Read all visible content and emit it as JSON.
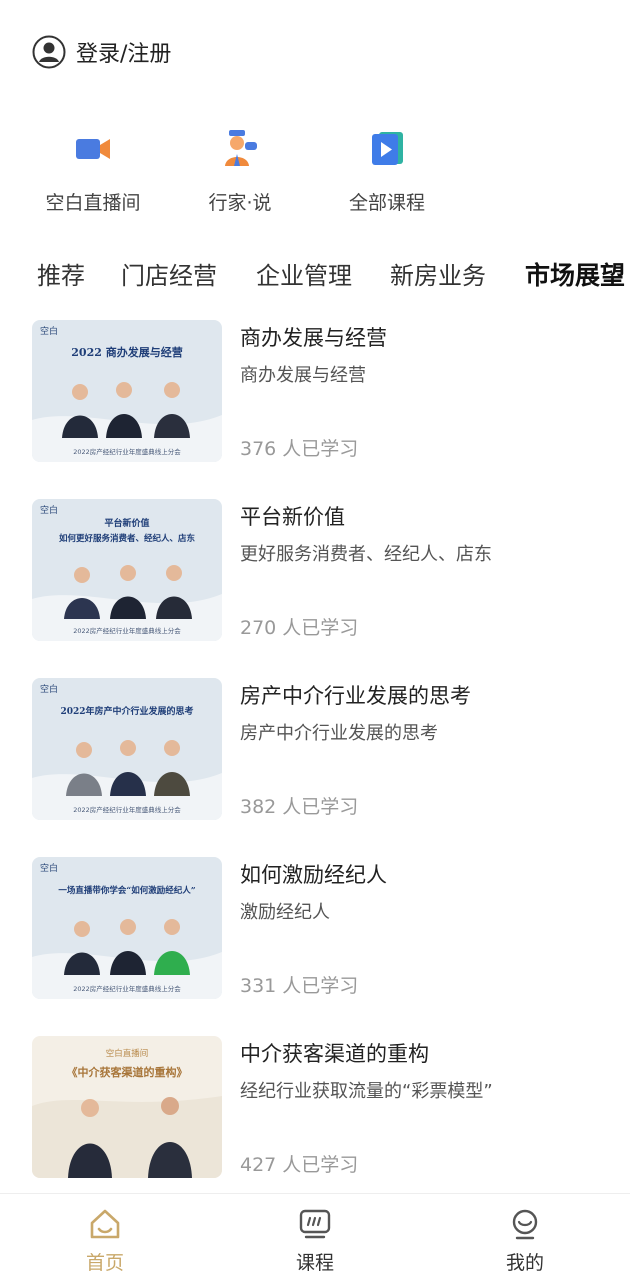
{
  "header": {
    "login_label": "登录/注册",
    "avatar_icon": "user-circle-icon"
  },
  "quick_links": [
    {
      "label": "空白直播间",
      "icon": "video-camera-icon",
      "color": "#4a7be0"
    },
    {
      "label": "行家·说",
      "icon": "speaker-person-icon",
      "color": "#f08a3c"
    },
    {
      "label": "全部课程",
      "icon": "play-book-icon",
      "color": "#3f7ce8"
    }
  ],
  "tabs": [
    {
      "label": "推荐",
      "active": false
    },
    {
      "label": "门店经营",
      "active": false
    },
    {
      "label": "企业管理",
      "active": false
    },
    {
      "label": "新房业务",
      "active": false
    },
    {
      "label": "市场展望",
      "active": true
    }
  ],
  "courses": [
    {
      "title": "商办发展与经营",
      "subtitle": "商办发展与经营",
      "count": "376 人已学习",
      "thumb": {
        "logo": "空白",
        "heading": "2022 商办发展与经营",
        "footer": "2022房产经纪行业年度盛典线上分会"
      }
    },
    {
      "title": "平台新价值",
      "subtitle": "更好服务消费者、经纪人、店东",
      "count": "270 人已学习",
      "thumb": {
        "logo": "空白",
        "heading": "平台新价值",
        "heading2": "如何更好服务消费者、经纪人、店东",
        "footer": "2022房产经纪行业年度盛典线上分会"
      }
    },
    {
      "title": "房产中介行业发展的思考",
      "subtitle": "房产中介行业发展的思考",
      "count": "382 人已学习",
      "thumb": {
        "logo": "空白",
        "heading": "2022年房产中介行业发展的思考",
        "footer": "2022房产经纪行业年度盛典线上分会"
      }
    },
    {
      "title": "如何激励经纪人",
      "subtitle": "激励经纪人",
      "count": "331 人已学习",
      "thumb": {
        "logo": "空白",
        "heading": "一场直播带你学会“如何激励经纪人”",
        "footer": "2022房产经纪行业年度盛典线上分会"
      }
    },
    {
      "title": "中介获客渠道的重构",
      "subtitle": "经纪行业获取流量的“彩票模型”",
      "count": "427 人已学习",
      "thumb": {
        "logo": "空白直播间",
        "heading": "《中介获客渠道的重构》"
      }
    }
  ],
  "bottom_nav": [
    {
      "label": "首页",
      "icon": "home-icon",
      "active": true
    },
    {
      "label": "课程",
      "icon": "course-screen-icon",
      "active": false
    },
    {
      "label": "我的",
      "icon": "profile-icon",
      "active": false
    }
  ],
  "colors": {
    "accent": "#c9a86a",
    "tab_active": "#111111",
    "count_gray": "#999999"
  }
}
